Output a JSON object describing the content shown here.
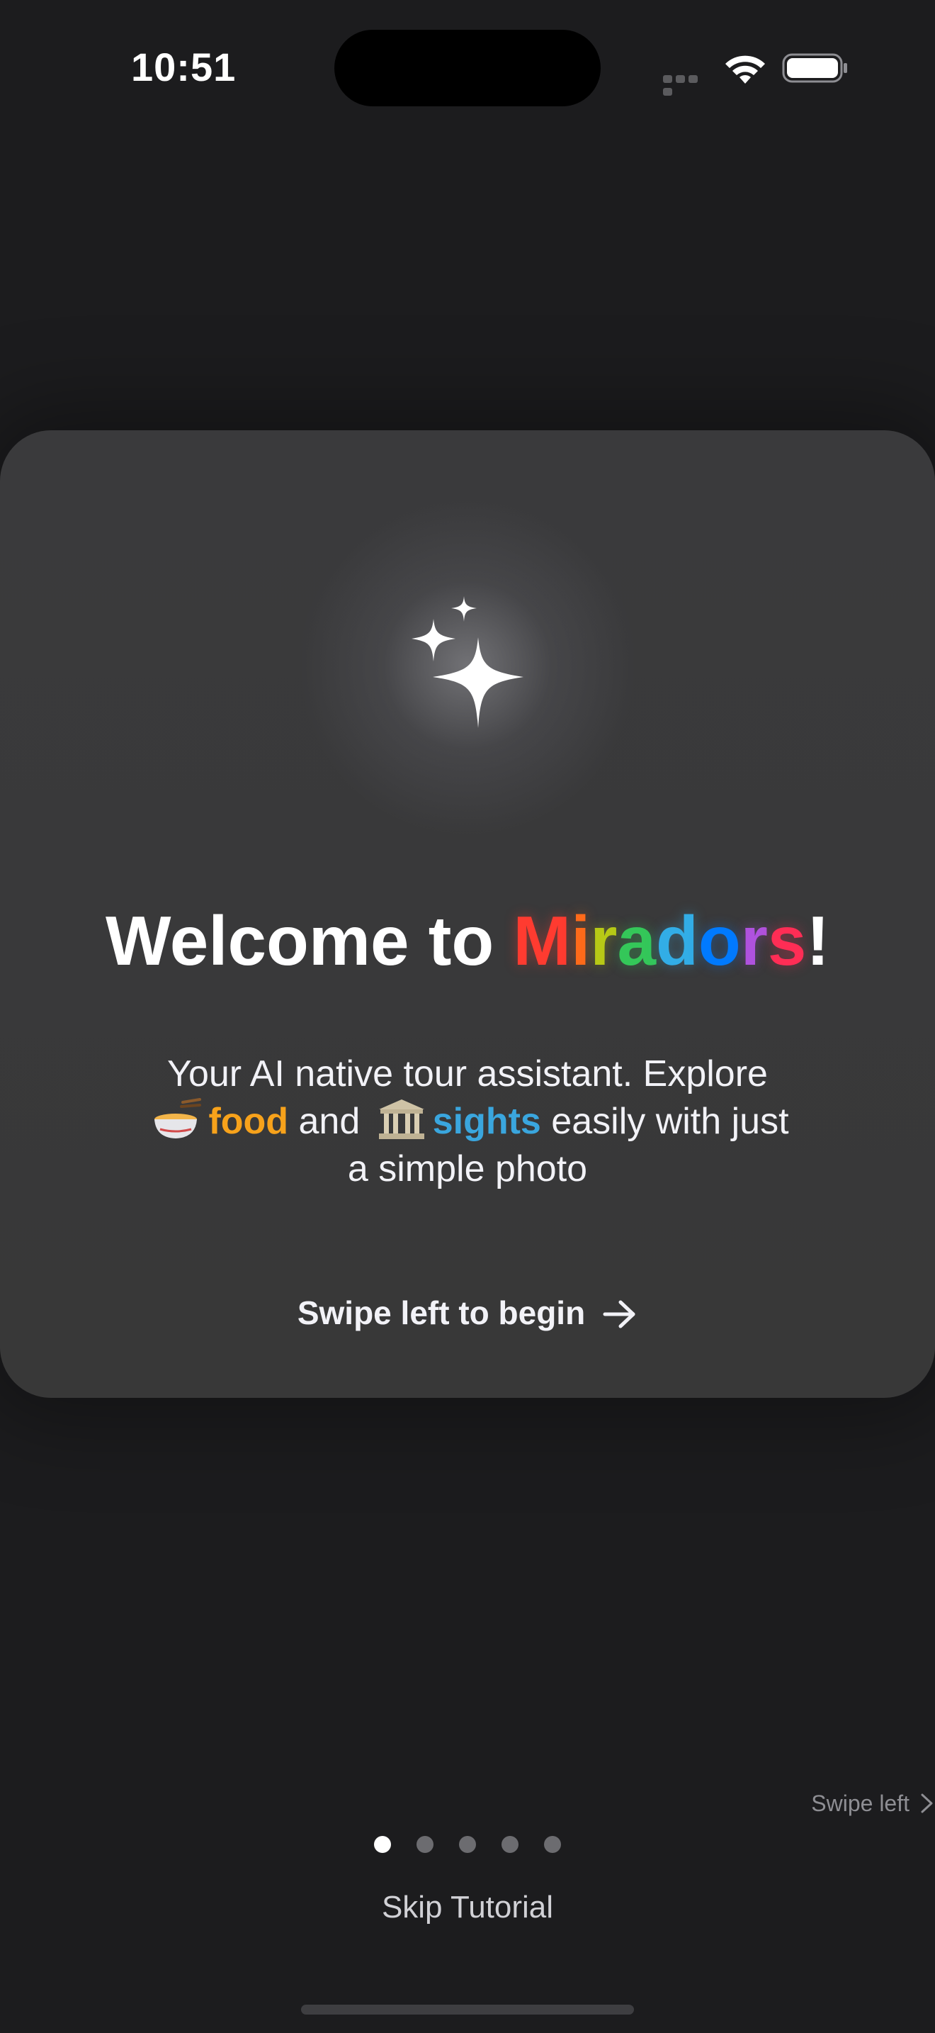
{
  "status_bar": {
    "time": "10:51"
  },
  "card": {
    "title_prefix": "Welcome to ",
    "brand_name_letters": [
      "M",
      "i",
      "r",
      "a",
      "d",
      "o",
      "r",
      "s"
    ],
    "brand_colors": [
      "#ff3b30",
      "#ff6a1a",
      "#ffb300",
      "#b7c916",
      "#34c759",
      "#32ade6",
      "#007aff",
      "#5856d6",
      "#af52de",
      "#ff2d55"
    ],
    "title_suffix": "!",
    "tagline_line1": "Your AI native tour assistant. Explore",
    "tagline_food": "food",
    "tagline_and": " and ",
    "tagline_sights": "sights",
    "tagline_rest": " easily with just",
    "tagline_line3": "a simple photo",
    "food_icon": "noodle-bowl-icon",
    "sights_icon": "classical-building-icon",
    "cta_label": "Swipe left to begin",
    "cta_icon": "arrow-right-icon",
    "hero_icon": "sparkles-icon"
  },
  "swipe_hint": "Swipe left",
  "pagination": {
    "total": 5,
    "current": 1
  },
  "skip_label": "Skip Tutorial"
}
